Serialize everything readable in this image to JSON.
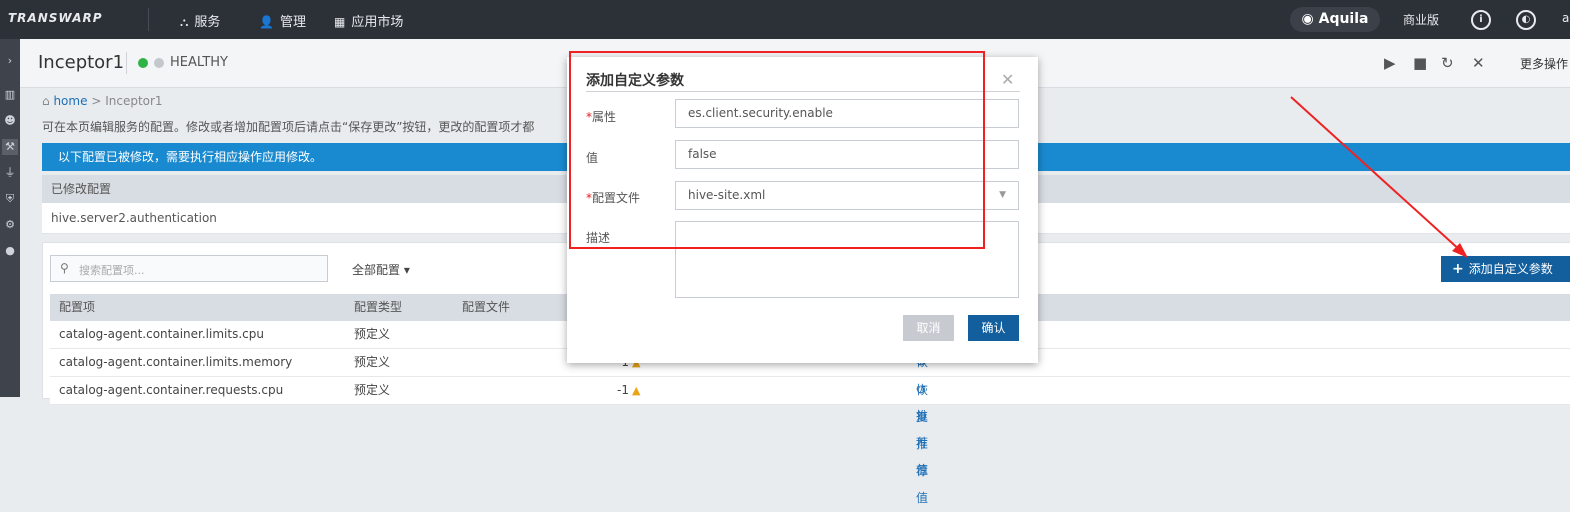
{
  "topbar": {
    "logo": "TRANSWARP",
    "nav": [
      {
        "label": "服务",
        "icon": "cluster-icon"
      },
      {
        "label": "管理",
        "icon": "person-icon"
      },
      {
        "label": "应用市场",
        "icon": "grid-icon"
      }
    ],
    "product": "Aquila",
    "edition": "商业版",
    "user_initial": "a"
  },
  "service": {
    "name": "Inceptor1",
    "status": "HEALTHY",
    "status_colors": {
      "ok": "#2fb344",
      "off": "#c4c8cd"
    },
    "more_actions": "更多操作"
  },
  "breadcrumb": {
    "home": "home",
    "sep": ">",
    "current": "Inceptor1"
  },
  "intro_text": "可在本页编辑服务的配置。修改或者增加配置项后请点击“保存更改”按钮，更改的配置项才都",
  "modified_notice": "以下配置已被修改，需要执行相应操作应用修改。",
  "modified": {
    "header": "已修改配置",
    "items": [
      "hive.server2.authentication"
    ]
  },
  "toolbar": {
    "search_placeholder": "搜索配置项...",
    "filter_label": "全部配置",
    "add_button": "添加自定义参数"
  },
  "table": {
    "headers": [
      "配置项",
      "配置类型",
      "配置文件"
    ],
    "rows": [
      {
        "name": "catalog-agent.container.limits.cpu",
        "type": "预定义",
        "value": "",
        "restore": ""
      },
      {
        "name": "catalog-agent.container.limits.memory",
        "type": "预定义",
        "value": "-1",
        "restore": "恢复推荐值"
      },
      {
        "name": "catalog-agent.container.requests.cpu",
        "type": "预定义",
        "value": "-1",
        "restore": "恢复推荐值"
      }
    ]
  },
  "dialog": {
    "title": "添加自定义参数",
    "fields": {
      "property": {
        "label": "属性",
        "value": "es.client.security.enable"
      },
      "value": {
        "label": "值",
        "value": "false"
      },
      "config_file": {
        "label": "配置文件",
        "value": "hive-site.xml"
      },
      "description": {
        "label": "描述",
        "value": ""
      }
    },
    "cancel": "取消",
    "confirm": "确认"
  },
  "colors": {
    "accent": "#135f9e",
    "info_bar": "#1a8ad0",
    "annotation": "#ee2222"
  }
}
